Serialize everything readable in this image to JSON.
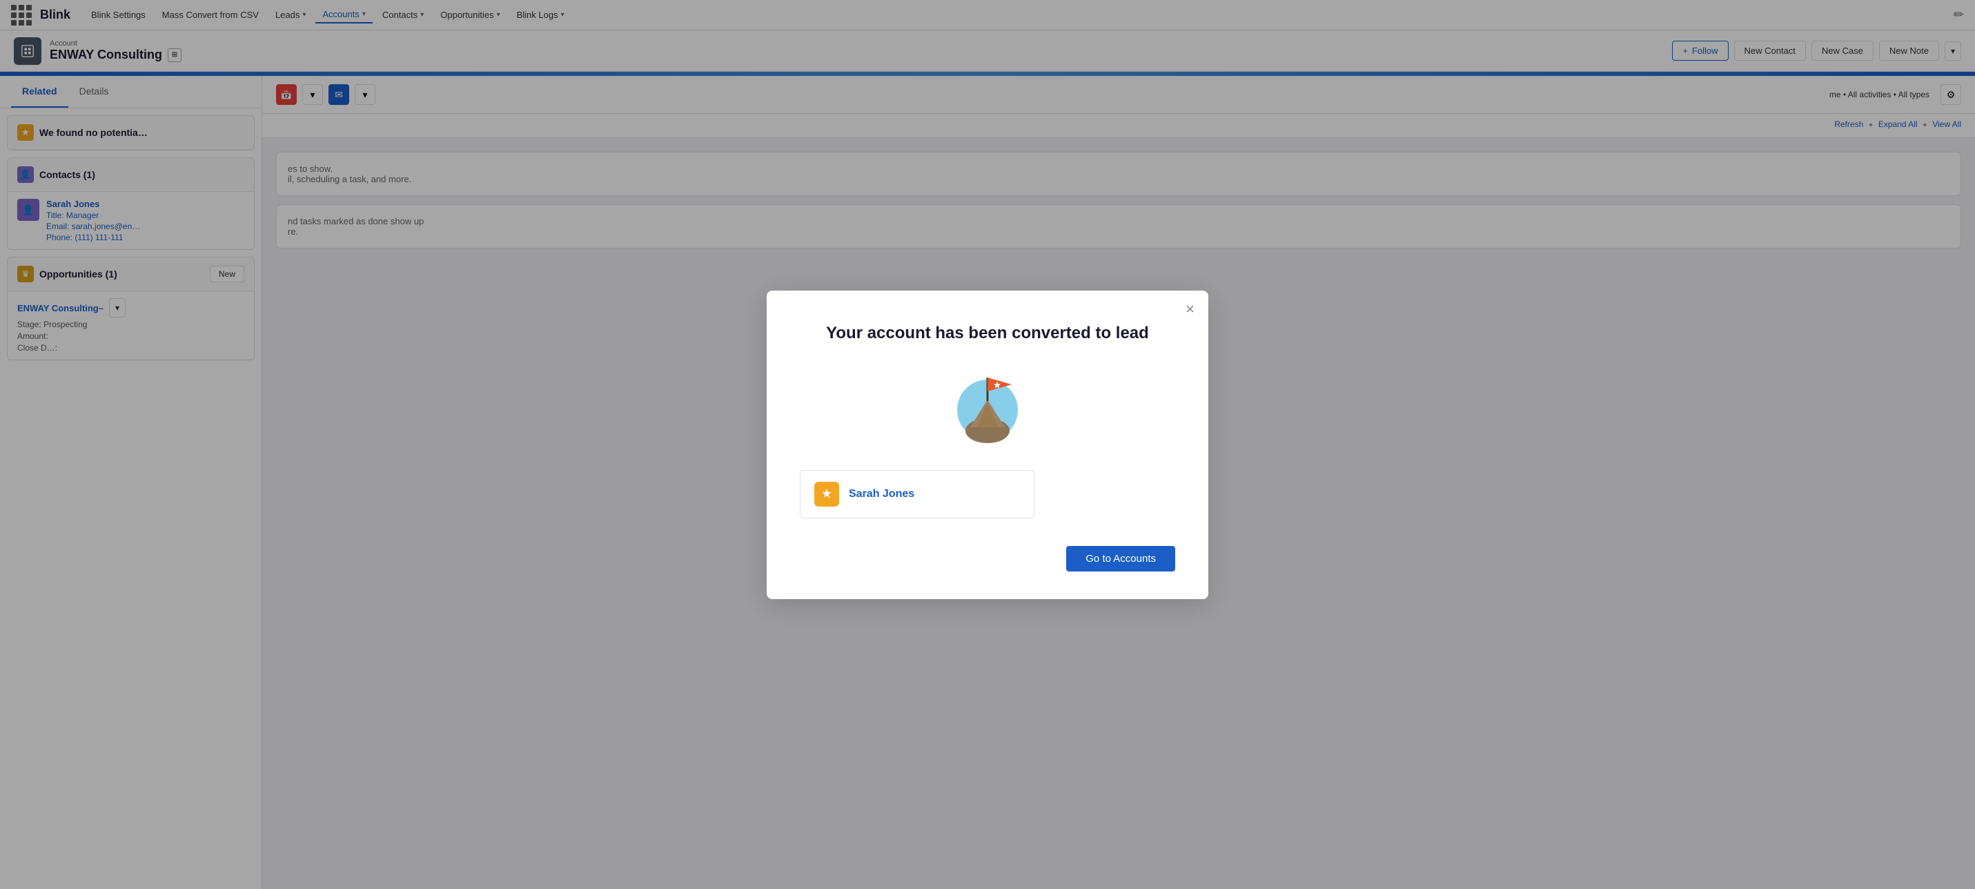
{
  "nav": {
    "brand": "Blink",
    "items": [
      {
        "label": "Blink Settings",
        "hasDropdown": false
      },
      {
        "label": "Mass Convert from CSV",
        "hasDropdown": false
      },
      {
        "label": "Leads",
        "hasDropdown": true
      },
      {
        "label": "Accounts",
        "hasDropdown": true,
        "active": true
      },
      {
        "label": "Contacts",
        "hasDropdown": true
      },
      {
        "label": "Opportunities",
        "hasDropdown": true
      },
      {
        "label": "Blink Logs",
        "hasDropdown": true
      }
    ]
  },
  "header": {
    "account_label": "Account",
    "account_name": "ENWAY Consulting",
    "follow_label": "Follow",
    "new_contact_label": "New Contact",
    "new_case_label": "New Case",
    "new_note_label": "New Note"
  },
  "tabs": {
    "related_label": "Related",
    "details_label": "Details"
  },
  "related": {
    "potential_section": {
      "title": "We found no potentia…",
      "icon": "★"
    },
    "contacts_section": {
      "title": "Contacts (1)",
      "contact": {
        "name": "Sarah Jones",
        "title_label": "Title:",
        "title_value": "Manager",
        "email_label": "Email:",
        "email_value": "sarah.jones@en…",
        "phone_label": "Phone:",
        "phone_value": "(111) 111-111"
      }
    },
    "opportunities_section": {
      "title": "Opportunities (1)",
      "new_label": "New",
      "opportunity": {
        "name": "ENWAY Consulting–",
        "stage_label": "Stage:",
        "stage_value": "Prospecting",
        "amount_label": "Amount:",
        "close_label": "Close D…:"
      }
    }
  },
  "activity_panel": {
    "filter_text": "me • All activities • All types",
    "refresh_label": "Refresh",
    "expand_all_label": "Expand All",
    "view_all_label": "View All",
    "empty_text1": "es to show.",
    "empty_text2": "il, scheduling a task, and more.",
    "empty_text3": "nd tasks marked as done show up",
    "empty_text4": "re."
  },
  "modal": {
    "title": "Your account has been converted to lead",
    "close_label": "×",
    "lead": {
      "name": "Sarah Jones",
      "icon": "★"
    },
    "go_to_accounts_label": "Go to Accounts"
  }
}
